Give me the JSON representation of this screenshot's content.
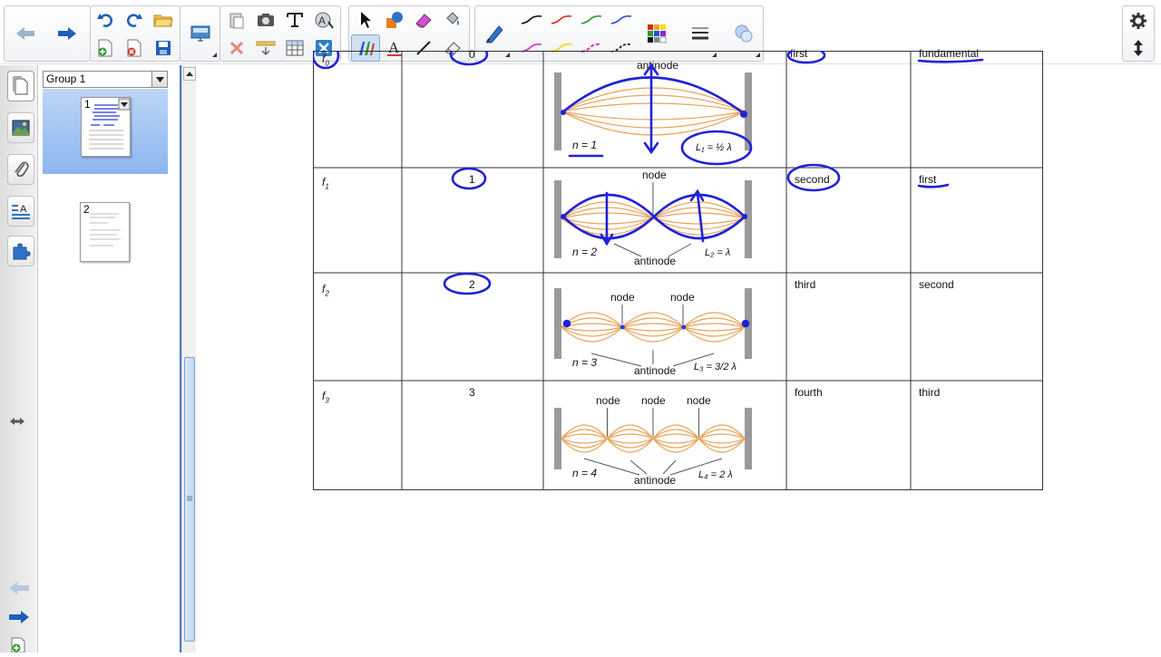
{
  "sorter": {
    "group_label": "Group 1",
    "pages": [
      {
        "number": "1"
      },
      {
        "number": "2"
      }
    ]
  },
  "table": {
    "rows": [
      {
        "freq": "f",
        "freq_sub": "0",
        "n": "0",
        "nodes_label": "",
        "antinode_label": "antinode",
        "n_label": "n = 1",
        "length_label": "L₁ = ½ λ",
        "harmonic": "first",
        "overtone": "fundamental"
      },
      {
        "freq": "f",
        "freq_sub": "1",
        "n": "1",
        "nodes_label": "node",
        "antinode_label": "antinode",
        "n_label": "n = 2",
        "length_label": "L₂ = λ",
        "harmonic": "second",
        "overtone": "first"
      },
      {
        "freq": "f",
        "freq_sub": "2",
        "n": "2",
        "nodes_label": "node",
        "antinode_label": "antinode",
        "n_label": "n = 3",
        "length_label": "L₃ = 3/2 λ",
        "harmonic": "third",
        "overtone": "second"
      },
      {
        "freq": "f",
        "freq_sub": "3",
        "n": "3",
        "nodes_label": "node",
        "antinode_label": "antinode",
        "n_label": "n = 4",
        "length_label": "L₄ = 2 λ",
        "harmonic": "fourth",
        "overtone": "third"
      }
    ]
  },
  "colors": {
    "ink_blue": "#1f22d6",
    "wave_orange": "#e8a35a",
    "accent": "#4b78c5"
  },
  "icons": {
    "toolbar": [
      "back-arrow-icon",
      "forward-arrow-icon",
      "undo-icon",
      "redo-icon",
      "open-folder-icon",
      "new-page-icon",
      "delete-page-icon",
      "save-icon",
      "screen-shade-icon",
      "paste-icon",
      "screen-capture-icon",
      "text-tool-icon",
      "magic-pen-icon",
      "delete-icon",
      "insert-icon",
      "table-icon",
      "clear-icon",
      "select-icon",
      "shapes-icon",
      "eraser-icon",
      "fill-icon",
      "pen-icon",
      "creative-pen-icon",
      "text-icon",
      "line-icon",
      "eraser2-icon",
      "pen-tool-icon",
      "color-palette-icon",
      "line-style-icon",
      "fill-effects-icon",
      "settings-gear-icon",
      "move-toolbar-icon"
    ]
  }
}
